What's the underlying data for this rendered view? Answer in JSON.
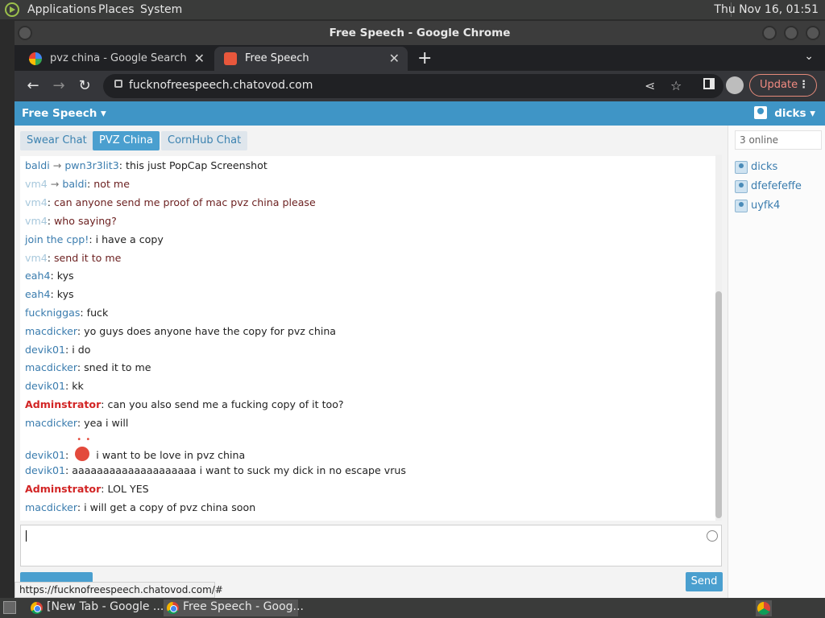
{
  "top_panel": {
    "menus": [
      "Applications",
      "Places",
      "System"
    ],
    "clock": "Thu Nov 16, 01:51"
  },
  "window": {
    "title": "Free Speech - Google Chrome"
  },
  "tabs": [
    {
      "label": "pvz china - Google Search",
      "active": false,
      "favicon": "google-icon"
    },
    {
      "label": "Free Speech",
      "active": true,
      "favicon": "chatovod-icon"
    }
  ],
  "toolbar": {
    "url": "fucknofreespeech.chatovod.com",
    "update_label": "Update"
  },
  "site": {
    "brand": "Free Speech ▾",
    "user": "dicks ▾"
  },
  "rooms": [
    {
      "label": "Swear Chat",
      "active": false
    },
    {
      "label": "PVZ China",
      "active": true
    },
    {
      "label": "CornHub Chat",
      "active": false
    }
  ],
  "messages": [
    {
      "from": "baldi",
      "to": "pwn3r3lit3",
      "text": "this just PopCap Screenshot"
    },
    {
      "from": "vm4",
      "to": "baldi",
      "text": "not me"
    },
    {
      "from": "vm4",
      "text": "can anyone send me proof of mac pvz china please"
    },
    {
      "from": "vm4",
      "text": "who saying?"
    },
    {
      "from": "join the cpp!",
      "text": "i have a copy"
    },
    {
      "from": "vm4",
      "text": "send it to me"
    },
    {
      "from": "eah4",
      "text": "kys"
    },
    {
      "from": "eah4",
      "text": "kys"
    },
    {
      "from": "fuckniggas",
      "text": "fuck"
    },
    {
      "from": "macdicker",
      "text": "yo guys does anyone have the copy for pvz china"
    },
    {
      "from": "devik01",
      "text": "i do"
    },
    {
      "from": "macdicker",
      "text": "sned it to me"
    },
    {
      "from": "devik01",
      "text": "kk"
    },
    {
      "from": "Adminstrator",
      "text": "can you also send me a fucking copy of it too?"
    },
    {
      "from": "macdicker",
      "text": "yea i will"
    },
    {
      "from": "devik01",
      "text": "i want to be love in pvz china",
      "emoji": "love-smiley-icon"
    },
    {
      "from": "devik01",
      "text": "aaaaaaaaaaaaaaaaaaaa i want to suck my dick in no escape vrus"
    },
    {
      "from": "Adminstrator",
      "text": "LOL YES"
    },
    {
      "from": "macdicker",
      "text": "i will get a copy of pvz china soon"
    }
  ],
  "composer": {
    "value": "",
    "send_label": "Send"
  },
  "status_url": "https://fucknofreespeech.chatovod.com/#",
  "users_panel": {
    "online_count": "3 online",
    "users": [
      "dicks",
      "dfefefeffe",
      "uyfk4"
    ]
  },
  "taskbar": {
    "items": [
      {
        "label": "[New Tab - Google ...",
        "active": false
      },
      {
        "label": "Free Speech - Goog...",
        "active": true
      }
    ]
  }
}
